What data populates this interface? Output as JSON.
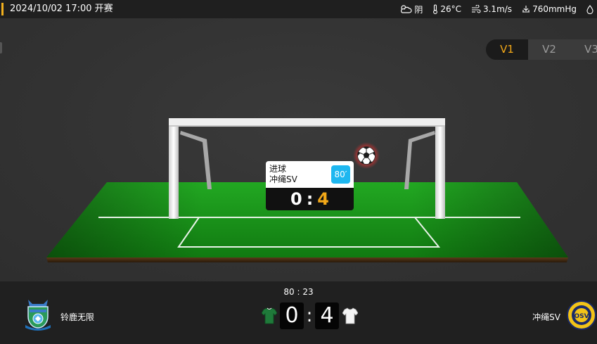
{
  "header": {
    "datetime": "2024/10/02 17:00",
    "status": "开赛",
    "weather": {
      "condition": "阴",
      "temperature": "26°C",
      "wind": "3.1m/s",
      "pressure": "760mmHg",
      "icons": [
        "cloudy-icon",
        "thermometer-icon",
        "wind-icon",
        "pressure-icon",
        "humidity-icon"
      ]
    }
  },
  "view_tabs": [
    {
      "label": "V1",
      "active": true
    },
    {
      "label": "V2",
      "active": false
    },
    {
      "label": "V3",
      "active": false
    }
  ],
  "goal_popup": {
    "event": "进球",
    "team": "冲绳SV",
    "minute": "80′",
    "score_home": "0",
    "score_sep": ":",
    "score_away": "4"
  },
  "scoreboard": {
    "clock": "80 : 23",
    "home_team": "铃鹿无限",
    "away_team": "冲绳SV",
    "home_score": "0",
    "separator": ":",
    "away_score": "4",
    "home_shirt_color": "#1f7a3a",
    "away_shirt_color": "#ffffff"
  },
  "colors": {
    "accent": "#f2a818",
    "minute_badge": "#1eb7f0",
    "grass": "#1f9e1f"
  }
}
